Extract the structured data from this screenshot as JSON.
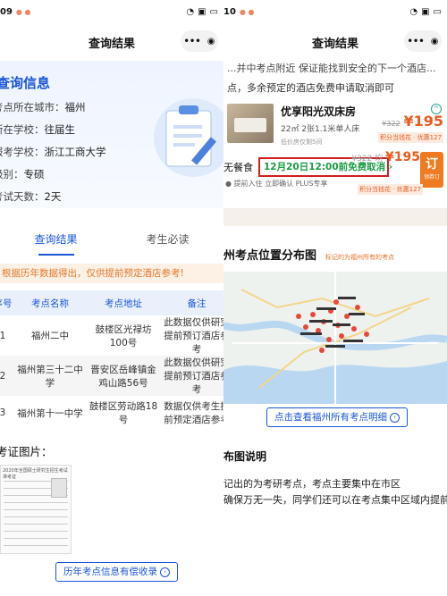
{
  "left": {
    "status": {
      "time": "09"
    },
    "nav": {
      "title": "查询结果"
    },
    "hero": {
      "title": "查询信息",
      "rows": [
        {
          "label": "考点所在城市：",
          "value": "福州"
        },
        {
          "label": "所在学校：",
          "value": "往届生"
        },
        {
          "label": "报考学校：",
          "value": "浙江工商大学"
        },
        {
          "label": "级别：",
          "value": "专硕"
        },
        {
          "label": "考试天数：",
          "value": "2天"
        }
      ]
    },
    "tabs": [
      {
        "label": "查询结果"
      },
      {
        "label": "考生必读"
      }
    ],
    "notice": "根据历年数据得出，仅供提前预定酒店参考!",
    "table": {
      "headers": [
        "序号",
        "考点名称",
        "考点地址",
        "备注"
      ],
      "rows": [
        [
          "1",
          "福州二中",
          "鼓楼区光禄坊100号",
          "此数据仅供研究提前预订酒店参考"
        ],
        [
          "2",
          "福州第三十二中学",
          "晋安区岳峰镇金鸡山路56号",
          "此数据仅供研究提前预订酒店参考"
        ],
        [
          "3",
          "福州第十一中学",
          "鼓楼区劳动路18号",
          "数据仅供考生提前预定酒店参考"
        ]
      ]
    },
    "ticket_title": "考证图片：",
    "ticket_caption": "2020年全国硕士研究生招生考试准考证",
    "history_button": "历年考点信息有偿收录"
  },
  "right": {
    "status": {
      "time": "10"
    },
    "nav": {
      "title": "查询结果"
    },
    "cut_line": "...并中考点附近 保证能找到安全的下一个酒店...",
    "policy": "点，多余预定的酒店免费申请取消即可",
    "room": {
      "name": "优享阳光双床房",
      "spec": "22㎡  2张1.1米单人床",
      "tag": "低价房仅剩5间",
      "old_price": "¥322",
      "price": "¥195",
      "badge": "积分当钱花 · 优惠127"
    },
    "meal": "无餐食",
    "cancel": "12月20日12:00前免费取消",
    "features": "● 提前入住   立即确认   PLUS专享",
    "price2": {
      "old": "¥322",
      "prefix": "均",
      "value": "¥195"
    },
    "book": {
      "label": "订",
      "sub": "领券订"
    },
    "points_badge": "积分当钱花 · 优惠127",
    "map": {
      "title": "州考点位置分布图",
      "subtitle": "标记的为福州所有的考点"
    },
    "map_button": "点击查看福州所有考点明细",
    "legend_title": "布图说明",
    "para": [
      "记出的为考研考点，考点主要集中在市区",
      "确保万无一失，同学们还可以在考点集中区域内提前预"
    ]
  }
}
